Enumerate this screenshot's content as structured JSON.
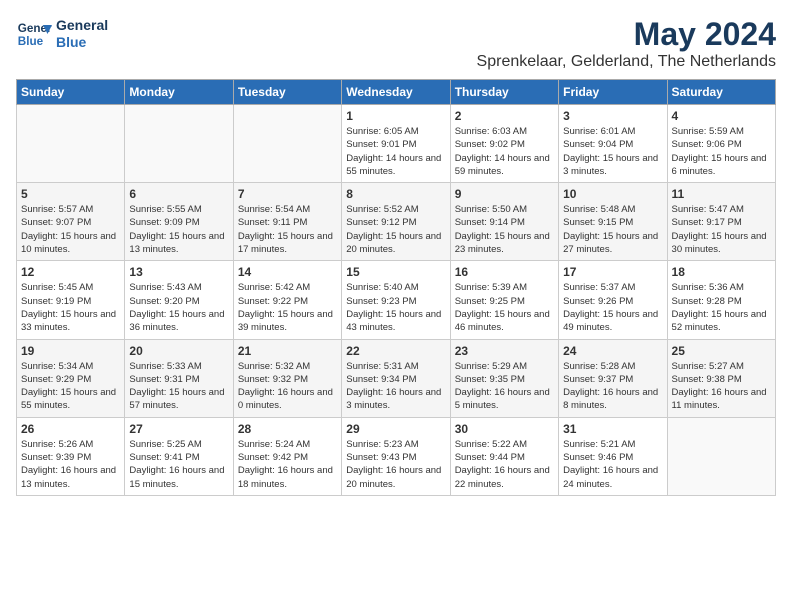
{
  "header": {
    "logo_line1": "General",
    "logo_line2": "Blue",
    "month_year": "May 2024",
    "location": "Sprenkelaar, Gelderland, The Netherlands"
  },
  "weekdays": [
    "Sunday",
    "Monday",
    "Tuesday",
    "Wednesday",
    "Thursday",
    "Friday",
    "Saturday"
  ],
  "weeks": [
    [
      {
        "day": "",
        "info": ""
      },
      {
        "day": "",
        "info": ""
      },
      {
        "day": "",
        "info": ""
      },
      {
        "day": "1",
        "info": "Sunrise: 6:05 AM\nSunset: 9:01 PM\nDaylight: 14 hours\nand 55 minutes."
      },
      {
        "day": "2",
        "info": "Sunrise: 6:03 AM\nSunset: 9:02 PM\nDaylight: 14 hours\nand 59 minutes."
      },
      {
        "day": "3",
        "info": "Sunrise: 6:01 AM\nSunset: 9:04 PM\nDaylight: 15 hours\nand 3 minutes."
      },
      {
        "day": "4",
        "info": "Sunrise: 5:59 AM\nSunset: 9:06 PM\nDaylight: 15 hours\nand 6 minutes."
      }
    ],
    [
      {
        "day": "5",
        "info": "Sunrise: 5:57 AM\nSunset: 9:07 PM\nDaylight: 15 hours\nand 10 minutes."
      },
      {
        "day": "6",
        "info": "Sunrise: 5:55 AM\nSunset: 9:09 PM\nDaylight: 15 hours\nand 13 minutes."
      },
      {
        "day": "7",
        "info": "Sunrise: 5:54 AM\nSunset: 9:11 PM\nDaylight: 15 hours\nand 17 minutes."
      },
      {
        "day": "8",
        "info": "Sunrise: 5:52 AM\nSunset: 9:12 PM\nDaylight: 15 hours\nand 20 minutes."
      },
      {
        "day": "9",
        "info": "Sunrise: 5:50 AM\nSunset: 9:14 PM\nDaylight: 15 hours\nand 23 minutes."
      },
      {
        "day": "10",
        "info": "Sunrise: 5:48 AM\nSunset: 9:15 PM\nDaylight: 15 hours\nand 27 minutes."
      },
      {
        "day": "11",
        "info": "Sunrise: 5:47 AM\nSunset: 9:17 PM\nDaylight: 15 hours\nand 30 minutes."
      }
    ],
    [
      {
        "day": "12",
        "info": "Sunrise: 5:45 AM\nSunset: 9:19 PM\nDaylight: 15 hours\nand 33 minutes."
      },
      {
        "day": "13",
        "info": "Sunrise: 5:43 AM\nSunset: 9:20 PM\nDaylight: 15 hours\nand 36 minutes."
      },
      {
        "day": "14",
        "info": "Sunrise: 5:42 AM\nSunset: 9:22 PM\nDaylight: 15 hours\nand 39 minutes."
      },
      {
        "day": "15",
        "info": "Sunrise: 5:40 AM\nSunset: 9:23 PM\nDaylight: 15 hours\nand 43 minutes."
      },
      {
        "day": "16",
        "info": "Sunrise: 5:39 AM\nSunset: 9:25 PM\nDaylight: 15 hours\nand 46 minutes."
      },
      {
        "day": "17",
        "info": "Sunrise: 5:37 AM\nSunset: 9:26 PM\nDaylight: 15 hours\nand 49 minutes."
      },
      {
        "day": "18",
        "info": "Sunrise: 5:36 AM\nSunset: 9:28 PM\nDaylight: 15 hours\nand 52 minutes."
      }
    ],
    [
      {
        "day": "19",
        "info": "Sunrise: 5:34 AM\nSunset: 9:29 PM\nDaylight: 15 hours\nand 55 minutes."
      },
      {
        "day": "20",
        "info": "Sunrise: 5:33 AM\nSunset: 9:31 PM\nDaylight: 15 hours\nand 57 minutes."
      },
      {
        "day": "21",
        "info": "Sunrise: 5:32 AM\nSunset: 9:32 PM\nDaylight: 16 hours\nand 0 minutes."
      },
      {
        "day": "22",
        "info": "Sunrise: 5:31 AM\nSunset: 9:34 PM\nDaylight: 16 hours\nand 3 minutes."
      },
      {
        "day": "23",
        "info": "Sunrise: 5:29 AM\nSunset: 9:35 PM\nDaylight: 16 hours\nand 5 minutes."
      },
      {
        "day": "24",
        "info": "Sunrise: 5:28 AM\nSunset: 9:37 PM\nDaylight: 16 hours\nand 8 minutes."
      },
      {
        "day": "25",
        "info": "Sunrise: 5:27 AM\nSunset: 9:38 PM\nDaylight: 16 hours\nand 11 minutes."
      }
    ],
    [
      {
        "day": "26",
        "info": "Sunrise: 5:26 AM\nSunset: 9:39 PM\nDaylight: 16 hours\nand 13 minutes."
      },
      {
        "day": "27",
        "info": "Sunrise: 5:25 AM\nSunset: 9:41 PM\nDaylight: 16 hours\nand 15 minutes."
      },
      {
        "day": "28",
        "info": "Sunrise: 5:24 AM\nSunset: 9:42 PM\nDaylight: 16 hours\nand 18 minutes."
      },
      {
        "day": "29",
        "info": "Sunrise: 5:23 AM\nSunset: 9:43 PM\nDaylight: 16 hours\nand 20 minutes."
      },
      {
        "day": "30",
        "info": "Sunrise: 5:22 AM\nSunset: 9:44 PM\nDaylight: 16 hours\nand 22 minutes."
      },
      {
        "day": "31",
        "info": "Sunrise: 5:21 AM\nSunset: 9:46 PM\nDaylight: 16 hours\nand 24 minutes."
      },
      {
        "day": "",
        "info": ""
      }
    ]
  ]
}
